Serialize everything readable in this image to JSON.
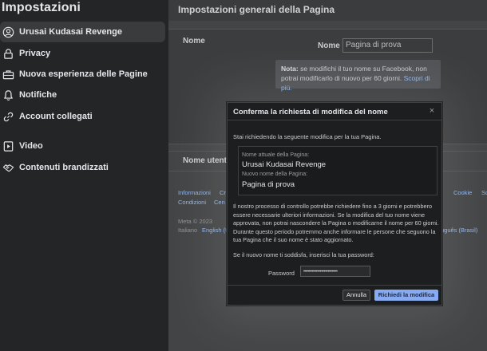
{
  "sidebar": {
    "title": "Impostazioni",
    "items": [
      {
        "label": "Urusai Kudasai Revenge",
        "icon": "user-circle-icon",
        "active": true
      },
      {
        "label": "Privacy",
        "icon": "lock-icon"
      },
      {
        "label": "Nuova esperienza delle Pagine",
        "icon": "briefcase-icon"
      },
      {
        "label": "Notifiche",
        "icon": "bell-icon"
      },
      {
        "label": "Account collegati",
        "icon": "link-icon"
      },
      {
        "label": "Video",
        "icon": "video-icon"
      },
      {
        "label": "Contenuti brandizzati",
        "icon": "handshake-icon"
      }
    ]
  },
  "main": {
    "title": "Impostazioni generali della Pagina",
    "name_section_label": "Nome",
    "name_field_label": "Nome",
    "name_field_value": "Pagina di prova",
    "note_bold": "Nota:",
    "note_text": " se modifichi il tuo nome su Facebook, non potrai modificarlo di nuovo per 60 giorni. ",
    "note_link": "Scopri di più.",
    "username_label": "Nome utente"
  },
  "footer": {
    "row1": [
      "Informazioni",
      "Cr",
      "Cookie",
      "Sc"
    ],
    "row2": [
      "Condizioni",
      "Cen"
    ],
    "meta": "Meta © 2023",
    "languages": [
      "Italiano",
      "English (U",
      "uguês (Brasil)"
    ]
  },
  "modal": {
    "title": "Conferma la richiesta di modifica del nome",
    "close": "×",
    "intro": "Stai richiedendo la seguente modifica per la tua Pagina.",
    "current_label": "Nome attuale della Pagina:",
    "current_value": "Urusai Kudasai Revenge",
    "new_label": "Nuovo nome della Pagina:",
    "new_value": "Pagina di prova",
    "paragraph": "Il nostro processo di controllo potrebbe richiedere fino a 3 giorni e potrebbero essere necessarie ulteriori informazioni. Se la modifica del tuo nome viene approvata, non potrai nascondere la Pagina o modificarne il nome per 60 giorni. Durante questo periodo potremmo anche informare le persone che seguono la tua Pagina che il suo nome è stato aggiornato.",
    "satisfied": "Se il nuovo nome ti soddisfa, inserisci la tua password:",
    "password_label": "Password",
    "password_value": "•••••••••••••••••••••••••",
    "cancel_label": "Annulla",
    "submit_label": "Richiedi la modifica"
  },
  "colors": {
    "accent": "#87aaf0",
    "link": "#8fb4ea",
    "sidebar_bg": "#242526",
    "modal_bg": "#1d1e1f"
  }
}
